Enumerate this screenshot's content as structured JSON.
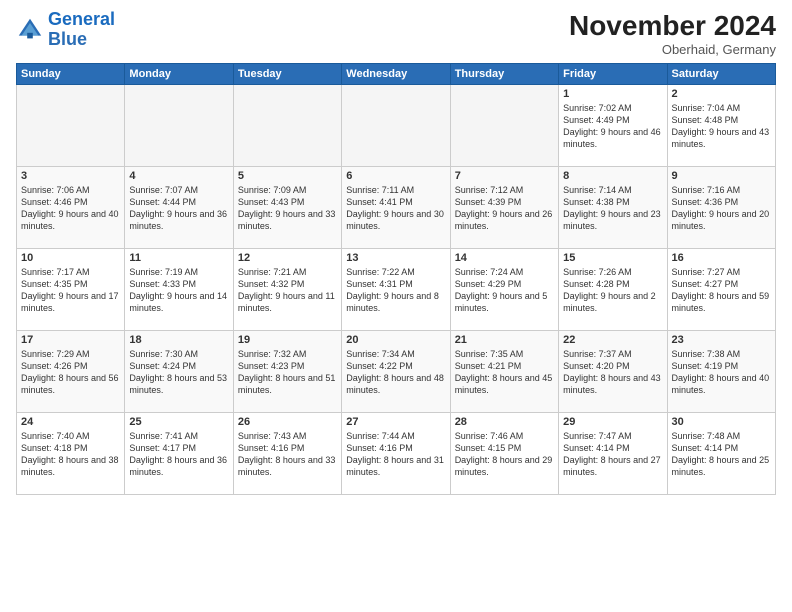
{
  "header": {
    "logo_line1": "General",
    "logo_line2": "Blue",
    "month": "November 2024",
    "location": "Oberhaid, Germany"
  },
  "weekdays": [
    "Sunday",
    "Monday",
    "Tuesday",
    "Wednesday",
    "Thursday",
    "Friday",
    "Saturday"
  ],
  "weeks": [
    [
      {
        "day": "",
        "info": ""
      },
      {
        "day": "",
        "info": ""
      },
      {
        "day": "",
        "info": ""
      },
      {
        "day": "",
        "info": ""
      },
      {
        "day": "",
        "info": ""
      },
      {
        "day": "1",
        "info": "Sunrise: 7:02 AM\nSunset: 4:49 PM\nDaylight: 9 hours and 46 minutes."
      },
      {
        "day": "2",
        "info": "Sunrise: 7:04 AM\nSunset: 4:48 PM\nDaylight: 9 hours and 43 minutes."
      }
    ],
    [
      {
        "day": "3",
        "info": "Sunrise: 7:06 AM\nSunset: 4:46 PM\nDaylight: 9 hours and 40 minutes."
      },
      {
        "day": "4",
        "info": "Sunrise: 7:07 AM\nSunset: 4:44 PM\nDaylight: 9 hours and 36 minutes."
      },
      {
        "day": "5",
        "info": "Sunrise: 7:09 AM\nSunset: 4:43 PM\nDaylight: 9 hours and 33 minutes."
      },
      {
        "day": "6",
        "info": "Sunrise: 7:11 AM\nSunset: 4:41 PM\nDaylight: 9 hours and 30 minutes."
      },
      {
        "day": "7",
        "info": "Sunrise: 7:12 AM\nSunset: 4:39 PM\nDaylight: 9 hours and 26 minutes."
      },
      {
        "day": "8",
        "info": "Sunrise: 7:14 AM\nSunset: 4:38 PM\nDaylight: 9 hours and 23 minutes."
      },
      {
        "day": "9",
        "info": "Sunrise: 7:16 AM\nSunset: 4:36 PM\nDaylight: 9 hours and 20 minutes."
      }
    ],
    [
      {
        "day": "10",
        "info": "Sunrise: 7:17 AM\nSunset: 4:35 PM\nDaylight: 9 hours and 17 minutes."
      },
      {
        "day": "11",
        "info": "Sunrise: 7:19 AM\nSunset: 4:33 PM\nDaylight: 9 hours and 14 minutes."
      },
      {
        "day": "12",
        "info": "Sunrise: 7:21 AM\nSunset: 4:32 PM\nDaylight: 9 hours and 11 minutes."
      },
      {
        "day": "13",
        "info": "Sunrise: 7:22 AM\nSunset: 4:31 PM\nDaylight: 9 hours and 8 minutes."
      },
      {
        "day": "14",
        "info": "Sunrise: 7:24 AM\nSunset: 4:29 PM\nDaylight: 9 hours and 5 minutes."
      },
      {
        "day": "15",
        "info": "Sunrise: 7:26 AM\nSunset: 4:28 PM\nDaylight: 9 hours and 2 minutes."
      },
      {
        "day": "16",
        "info": "Sunrise: 7:27 AM\nSunset: 4:27 PM\nDaylight: 8 hours and 59 minutes."
      }
    ],
    [
      {
        "day": "17",
        "info": "Sunrise: 7:29 AM\nSunset: 4:26 PM\nDaylight: 8 hours and 56 minutes."
      },
      {
        "day": "18",
        "info": "Sunrise: 7:30 AM\nSunset: 4:24 PM\nDaylight: 8 hours and 53 minutes."
      },
      {
        "day": "19",
        "info": "Sunrise: 7:32 AM\nSunset: 4:23 PM\nDaylight: 8 hours and 51 minutes."
      },
      {
        "day": "20",
        "info": "Sunrise: 7:34 AM\nSunset: 4:22 PM\nDaylight: 8 hours and 48 minutes."
      },
      {
        "day": "21",
        "info": "Sunrise: 7:35 AM\nSunset: 4:21 PM\nDaylight: 8 hours and 45 minutes."
      },
      {
        "day": "22",
        "info": "Sunrise: 7:37 AM\nSunset: 4:20 PM\nDaylight: 8 hours and 43 minutes."
      },
      {
        "day": "23",
        "info": "Sunrise: 7:38 AM\nSunset: 4:19 PM\nDaylight: 8 hours and 40 minutes."
      }
    ],
    [
      {
        "day": "24",
        "info": "Sunrise: 7:40 AM\nSunset: 4:18 PM\nDaylight: 8 hours and 38 minutes."
      },
      {
        "day": "25",
        "info": "Sunrise: 7:41 AM\nSunset: 4:17 PM\nDaylight: 8 hours and 36 minutes."
      },
      {
        "day": "26",
        "info": "Sunrise: 7:43 AM\nSunset: 4:16 PM\nDaylight: 8 hours and 33 minutes."
      },
      {
        "day": "27",
        "info": "Sunrise: 7:44 AM\nSunset: 4:16 PM\nDaylight: 8 hours and 31 minutes."
      },
      {
        "day": "28",
        "info": "Sunrise: 7:46 AM\nSunset: 4:15 PM\nDaylight: 8 hours and 29 minutes."
      },
      {
        "day": "29",
        "info": "Sunrise: 7:47 AM\nSunset: 4:14 PM\nDaylight: 8 hours and 27 minutes."
      },
      {
        "day": "30",
        "info": "Sunrise: 7:48 AM\nSunset: 4:14 PM\nDaylight: 8 hours and 25 minutes."
      }
    ]
  ]
}
